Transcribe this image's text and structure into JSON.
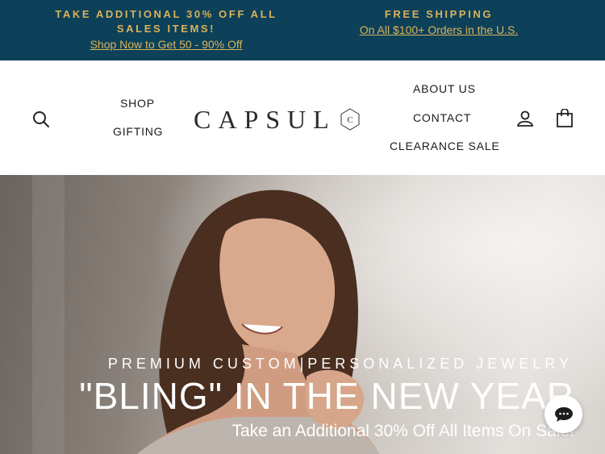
{
  "announcement": {
    "left": {
      "headline": "TAKE ADDITIONAL 30% OFF ALL SALES ITEMS!",
      "link": "Shop Now to Get 50 - 90% Off"
    },
    "right": {
      "headline": "FREE SHIPPING",
      "link": "On All $100+ Orders in the U.S."
    },
    "colors": {
      "background": "#0d4059",
      "text": "#d9b35a"
    }
  },
  "header": {
    "logo_text": "CAPSUL",
    "logo_mark": "C",
    "nav_left": [
      "SHOP",
      "GIFTING"
    ],
    "nav_right": [
      "ABOUT US",
      "CONTACT",
      "CLEARANCE SALE"
    ],
    "icons": [
      "search-icon",
      "account-icon",
      "cart-icon"
    ]
  },
  "hero": {
    "kicker": "PREMIUM CUSTOM|PERSONALIZED JEWELRY",
    "title": "\"BLING\" IN THE NEW YEAR",
    "subtitle": "Take an Additional 30% Off All Items On Sale!"
  },
  "chat": {
    "icon": "chat-bubble-icon"
  }
}
